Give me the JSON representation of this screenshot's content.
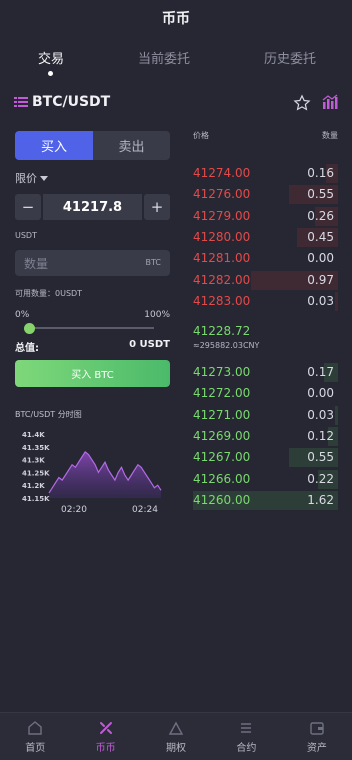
{
  "header": {
    "title": "币币"
  },
  "tabs": [
    {
      "label": "交易"
    },
    {
      "label": "当前委托"
    },
    {
      "label": "历史委托"
    }
  ],
  "pair": {
    "symbol": "BTC/USDT"
  },
  "trade_form": {
    "buy_label": "买入",
    "sell_label": "卖出",
    "order_type": "限价",
    "price_value": "41217.8",
    "minus": "−",
    "plus": "+",
    "currency_label": "USDT",
    "qty_placeholder": "数量",
    "qty_unit": "BTC",
    "available": "可用数量：0USDT",
    "pct_min": "0%",
    "pct_max": "100%",
    "slider_value": 0,
    "total_label": "总值:",
    "total_value": "0 USDT",
    "submit_label": "买入 BTC"
  },
  "mini_chart": {
    "title": "BTC/USDT 分时图",
    "chart_data": {
      "type": "area",
      "x_ticks": [
        "02:20",
        "02:24"
      ],
      "y_ticks": [
        "41.4K",
        "41.35K",
        "41.3K",
        "41.25K",
        "41.2K",
        "41.15K"
      ],
      "values": [
        41.17,
        41.19,
        41.21,
        41.23,
        41.22,
        41.24,
        41.26,
        41.28,
        41.27,
        41.29,
        41.31,
        41.33,
        41.32,
        41.3,
        41.28,
        41.25,
        41.27,
        41.29,
        41.26,
        41.24,
        41.22,
        41.25,
        41.27,
        41.24,
        41.22,
        41.24,
        41.26,
        41.28,
        41.27,
        41.25,
        41.23,
        41.21,
        41.19,
        41.2,
        41.18
      ],
      "ylim": [
        41.15,
        41.4
      ]
    }
  },
  "orderbook": {
    "price_header": "价格",
    "qty_header": "数量",
    "asks": [
      {
        "price": "41274.00",
        "qty": "0.16",
        "depth": 0.08
      },
      {
        "price": "41276.00",
        "qty": "0.55",
        "depth": 0.34
      },
      {
        "price": "41279.00",
        "qty": "0.26",
        "depth": 0.16
      },
      {
        "price": "41280.00",
        "qty": "0.45",
        "depth": 0.28
      },
      {
        "price": "41281.00",
        "qty": "0.00",
        "depth": 0.0
      },
      {
        "price": "41282.00",
        "qty": "0.97",
        "depth": 0.6
      },
      {
        "price": "41283.00",
        "qty": "0.03",
        "depth": 0.02
      }
    ],
    "mid_price": "41228.72",
    "mid_cny": "≈295882.03CNY",
    "bids": [
      {
        "price": "41273.00",
        "qty": "0.17",
        "depth": 0.1
      },
      {
        "price": "41272.00",
        "qty": "0.00",
        "depth": 0.0
      },
      {
        "price": "41271.00",
        "qty": "0.03",
        "depth": 0.02
      },
      {
        "price": "41269.00",
        "qty": "0.12",
        "depth": 0.07
      },
      {
        "price": "41267.00",
        "qty": "0.55",
        "depth": 0.34
      },
      {
        "price": "41266.00",
        "qty": "0.22",
        "depth": 0.14
      },
      {
        "price": "41260.00",
        "qty": "1.62",
        "depth": 1.0
      }
    ]
  },
  "footer": [
    {
      "label": "首页",
      "icon": "home-icon"
    },
    {
      "label": "币币",
      "icon": "coin-icon"
    },
    {
      "label": "期权",
      "icon": "options-icon"
    },
    {
      "label": "合约",
      "icon": "contract-icon"
    },
    {
      "label": "资产",
      "icon": "wallet-icon"
    }
  ],
  "colors": {
    "accent_buy": "#4f62e8",
    "up": "#7ad96f",
    "down": "#e34a4a",
    "active_nav": "#c25bd8"
  }
}
